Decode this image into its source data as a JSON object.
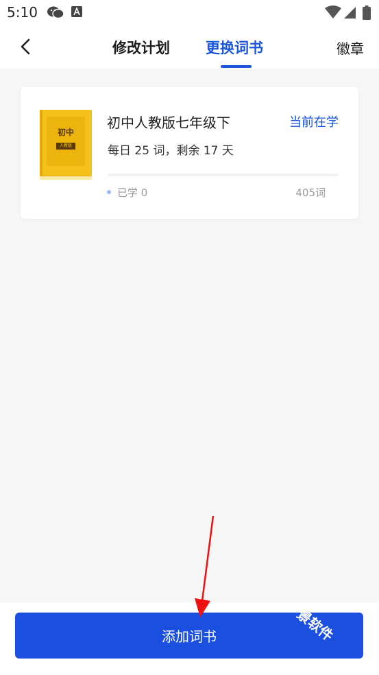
{
  "status_bar": {
    "time": "5:10",
    "icons": [
      "wechat-icon",
      "font-icon",
      "wifi-icon",
      "signal-icon",
      "battery-icon"
    ]
  },
  "nav": {
    "back_icon": "back-arrow-icon",
    "tabs": [
      {
        "label": "修改计划",
        "active": false
      },
      {
        "label": "更换词书",
        "active": true
      }
    ],
    "right_link": "徽章"
  },
  "book": {
    "cover": {
      "title": "初中",
      "tag": "人教版",
      "color": "#f5c11a"
    },
    "name": "初中人教版七年级下",
    "status": "当前在学",
    "plan": "每日 25 词，剩余 17 天",
    "learned": "已学 0",
    "total": "405词",
    "progress": 0
  },
  "add_button": {
    "label": "添加词书"
  },
  "watermark": "景软件"
}
